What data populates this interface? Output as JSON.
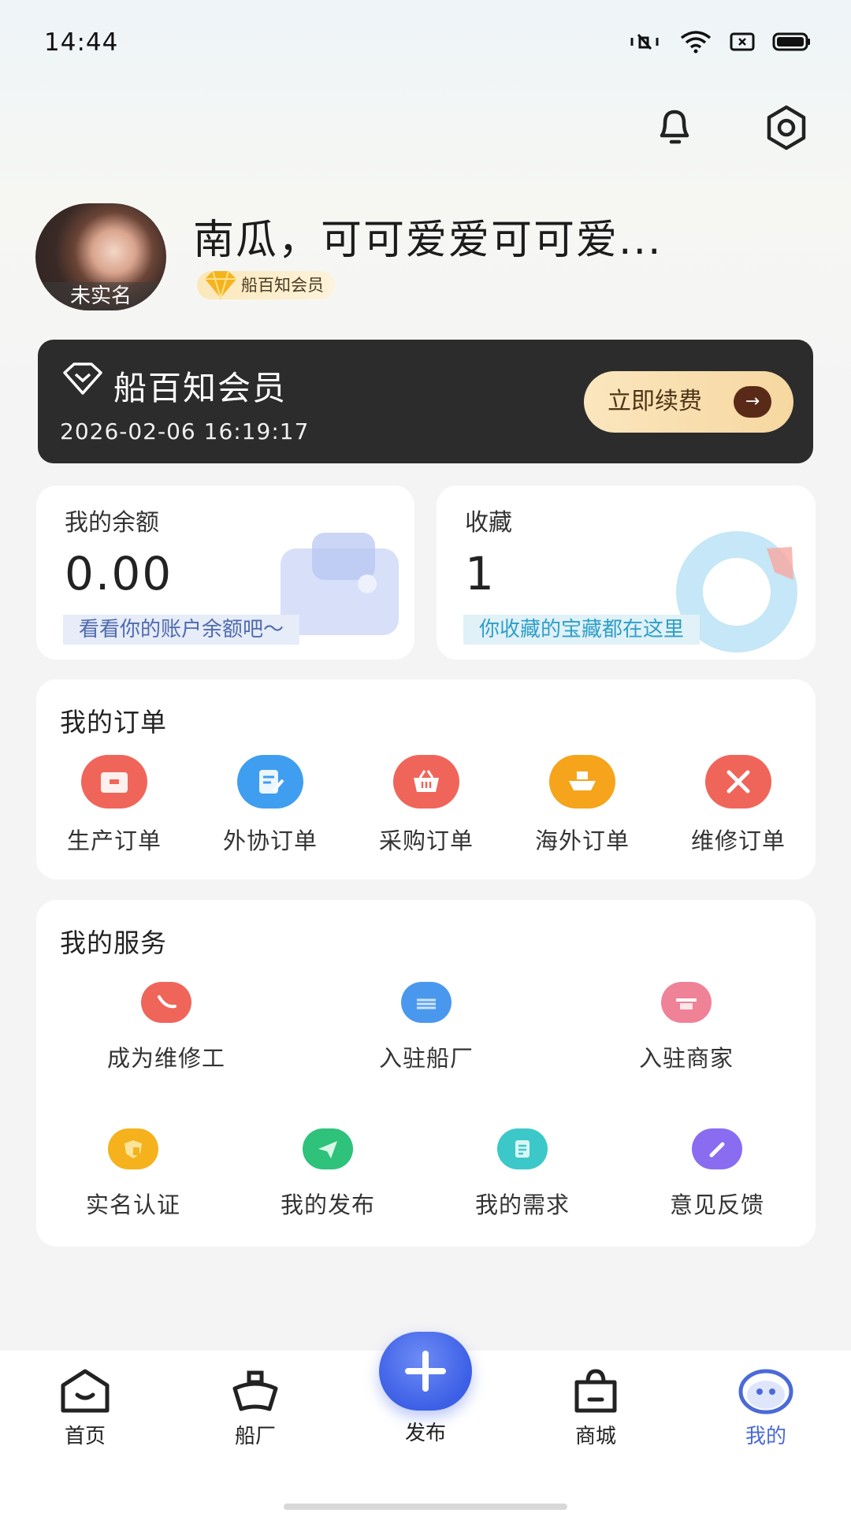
{
  "status_bar": {
    "time": "14:44"
  },
  "header": {
    "bell_icon": "bell-icon",
    "settings_icon": "gear-icon"
  },
  "profile": {
    "name": "南瓜，可可爱爱可可爱...",
    "avatar_tag": "未实名",
    "member_badge": "船百知会员"
  },
  "vip_card": {
    "title": "船百知会员",
    "expire": "2026-02-06 16:19:17",
    "renew_label": "立即续费"
  },
  "balance": {
    "label": "我的余额",
    "value": "0.00",
    "hint": "看看你的账户余额吧～"
  },
  "favorites": {
    "label": "收藏",
    "value": "1",
    "hint": "你收藏的宝藏都在这里"
  },
  "orders": {
    "title": "我的订单",
    "items": [
      {
        "label": "生产订单",
        "icon": "box-icon",
        "color": "#f0655a"
      },
      {
        "label": "外协订单",
        "icon": "edit-doc-icon",
        "color": "#3f9ef0"
      },
      {
        "label": "采购订单",
        "icon": "basket-icon",
        "color": "#f0655a"
      },
      {
        "label": "海外订单",
        "icon": "ship-icon",
        "color": "#f5a41c"
      },
      {
        "label": "维修订单",
        "icon": "tools-icon",
        "color": "#f0655a"
      }
    ]
  },
  "services": {
    "title": "我的服务",
    "items": [
      {
        "label": "成为维修工",
        "icon": "wrench-icon",
        "color": "#f0655a"
      },
      {
        "label": "入驻船厂",
        "icon": "shipyard-icon",
        "color": "#4a98ee"
      },
      {
        "label": "入驻商家",
        "icon": "store-icon",
        "color": "#f08298"
      },
      {
        "label": "实名认证",
        "icon": "shield-icon",
        "color": "#f5b21c"
      },
      {
        "label": "我的发布",
        "icon": "paper-plane-icon",
        "color": "#2fc27a"
      },
      {
        "label": "我的需求",
        "icon": "document-icon",
        "color": "#3cc8c8"
      },
      {
        "label": "意见反馈",
        "icon": "pencil-icon",
        "color": "#8a6cf0"
      }
    ]
  },
  "tabbar": {
    "items": [
      {
        "label": "首页",
        "icon": "home-icon"
      },
      {
        "label": "船厂",
        "icon": "ship-icon"
      },
      {
        "label": "发布",
        "icon": "plus-icon"
      },
      {
        "label": "商城",
        "icon": "shopping-bag-icon"
      },
      {
        "label": "我的",
        "icon": "profile-face-icon",
        "active": true
      }
    ]
  },
  "colors": {
    "accent": "#4b6ad8",
    "vip_bg": "#2c2c2c",
    "renew_bg": "#f6d7a0"
  }
}
